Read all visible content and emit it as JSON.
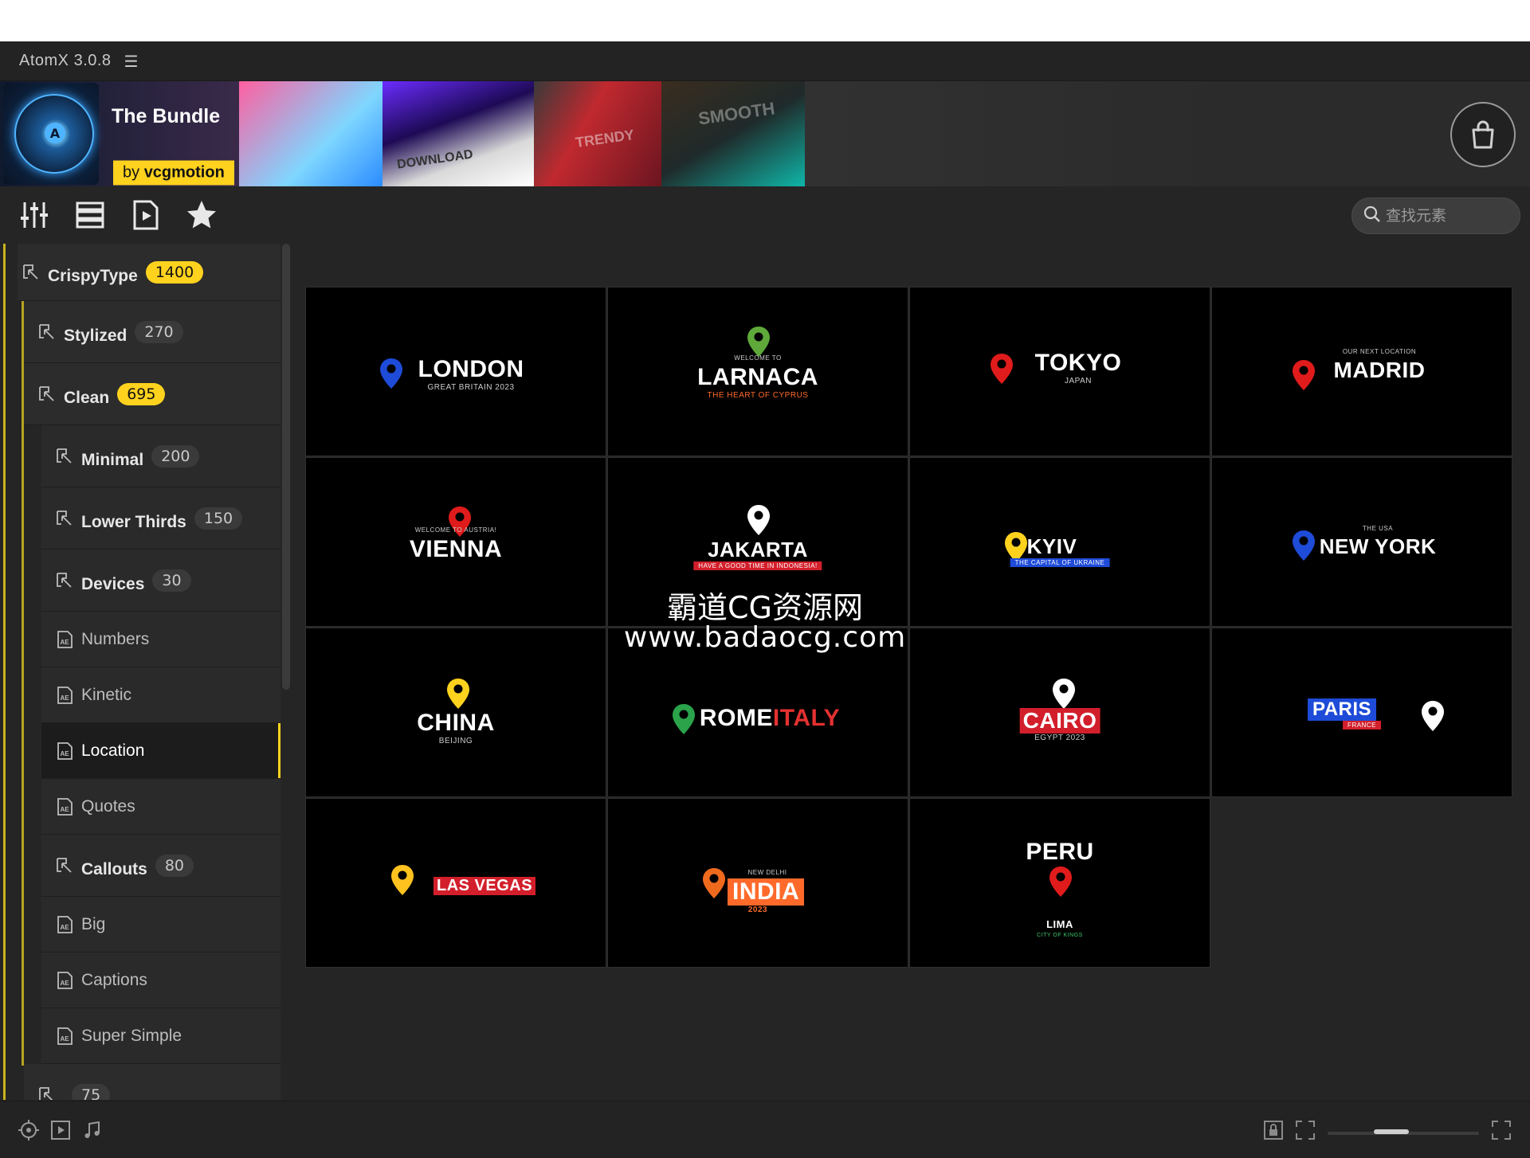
{
  "window": {
    "title": "AtomX 3.0.8",
    "menu_icon": "hamburger-icon"
  },
  "banner": {
    "title": "The Bundle",
    "by_prefix": "by",
    "by_name": "vcgmotion",
    "decor": [
      "DOWNLOAD",
      "TRENDY",
      "SMOOTH"
    ],
    "cart_icon": "shopping-bag-icon"
  },
  "toolbar": {
    "buttons": [
      "sliders-icon",
      "list-icon",
      "video-file-icon",
      "star-icon"
    ],
    "search_placeholder": "查找元素"
  },
  "sidebar": {
    "items": [
      {
        "label": "CrispyType",
        "count": "1400",
        "badge": "yellow"
      },
      {
        "label": "Stylized",
        "count": "270",
        "badge": "gray"
      },
      {
        "label": "Clean",
        "count": "695",
        "badge": "yellow"
      },
      {
        "label": "Minimal",
        "count": "200",
        "badge": "gray"
      },
      {
        "label": "Lower Thirds",
        "count": "150",
        "badge": "gray"
      },
      {
        "label": "Devices",
        "count": "30",
        "badge": "gray"
      },
      {
        "label": "Numbers"
      },
      {
        "label": "Kinetic"
      },
      {
        "label": "Location",
        "active": true
      },
      {
        "label": "Quotes"
      },
      {
        "label": "Callouts",
        "count": "80",
        "badge": "gray"
      },
      {
        "label": "Big"
      },
      {
        "label": "Captions"
      },
      {
        "label": "Super Simple"
      },
      {
        "label": "",
        "count": "75",
        "badge": "gray"
      }
    ]
  },
  "grid": {
    "tiles": [
      {
        "title": "LONDON",
        "sub": "GREAT BRITAIN 2023",
        "pin": "#1e4bd8"
      },
      {
        "title": "LARNACA",
        "pre": "WELCOME TO",
        "sub": "THE HEART OF CYPRUS",
        "pin": "#5ea93a"
      },
      {
        "title": "TOKYO",
        "sub": "JAPAN",
        "pin": "#e01b1b"
      },
      {
        "title": "MADRID",
        "pre": "OUR NEXT LOCATION",
        "pin": "#e01b1b"
      },
      {
        "title": "VIENNA",
        "pre": "WELCOME TO AUSTRIA!",
        "pin": "#e01b1b"
      },
      {
        "title": "JAKARTA",
        "sub": "HAVE A GOOD TIME IN INDONESIA!",
        "pin": "#ffffff"
      },
      {
        "title": "KYIV",
        "sub": "THE CAPITAL OF UKRAINE",
        "pin": "#ffd21e"
      },
      {
        "title": "NEW YORK",
        "pre": "THE USA",
        "pin": "#1e4bd8"
      },
      {
        "title": "CHINA",
        "sub": "BEIJING",
        "pin": "#ffd21e"
      },
      {
        "title": "ROME",
        "title2": "ITALY",
        "pin": "#2aa34a"
      },
      {
        "title": "CAIRO",
        "sub": "EGYPT 2023",
        "pin": "#ffffff"
      },
      {
        "title": "PARIS",
        "sub": "FRANCE",
        "pin": "#ffffff"
      },
      {
        "title": "LAS VEGAS",
        "pin": "#ffc21e"
      },
      {
        "title": "INDIA",
        "pre": "NEW DELHI",
        "sub": "2023",
        "pin": "#f06a1e"
      },
      {
        "title": "PERU",
        "sub": "LIMA",
        "sub2": "CITY OF KINGS",
        "pin": "#e01b1b"
      }
    ]
  },
  "watermark": {
    "line1": "霸道CG资源网",
    "line2": "www.badaocg.com"
  },
  "footer": {
    "left_icons": [
      "target-icon",
      "play-icon",
      "music-icon"
    ],
    "right_icons": [
      "lock-icon",
      "fit-icon",
      "fullscreen-icon"
    ]
  },
  "colors": {
    "accent": "#ffd21e",
    "bg": "#252525"
  }
}
